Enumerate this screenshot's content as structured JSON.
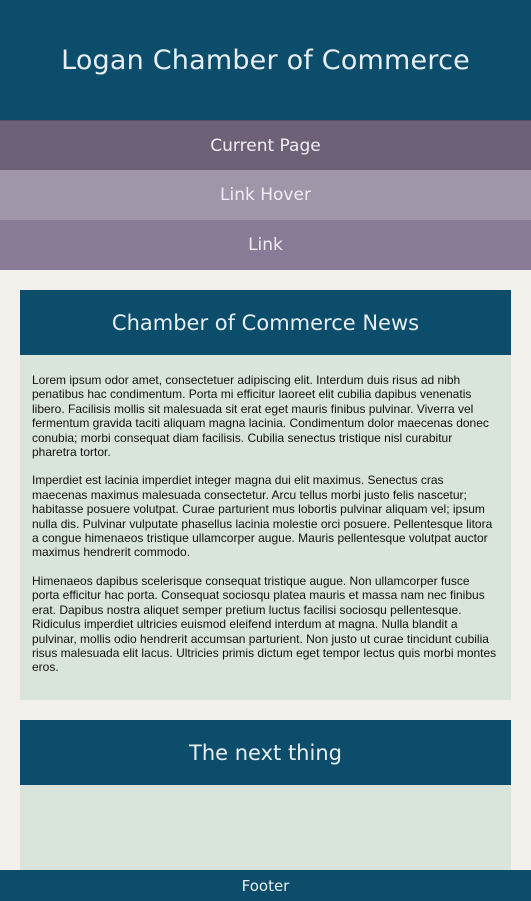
{
  "header": {
    "title": "Logan Chamber of Commerce"
  },
  "nav": {
    "items": [
      {
        "label": "Current Page",
        "state": "current"
      },
      {
        "label": "Link Hover",
        "state": "hover"
      },
      {
        "label": "Link",
        "state": "default"
      }
    ]
  },
  "main": {
    "cards": [
      {
        "title": "Chamber of Commerce News",
        "paragraphs": [
          "Lorem ipsum odor amet, consectetuer adipiscing elit. Interdum duis risus ad nibh penatibus hac condimentum. Porta mi efficitur laoreet elit cubilia dapibus venenatis libero. Facilisis mollis sit malesuada sit erat eget mauris finibus pulvinar. Viverra vel fermentum gravida taciti aliquam magna lacinia. Condimentum dolor maecenas donec conubia; morbi consequat diam facilisis. Cubilia senectus tristique nisl curabitur pharetra tortor.",
          "Imperdiet est lacinia imperdiet integer magna dui elit maximus. Senectus cras maecenas maximus malesuada consectetur. Arcu tellus morbi justo felis nascetur; habitasse posuere volutpat. Curae parturient mus lobortis pulvinar aliquam vel; ipsum nulla dis. Pulvinar vulputate phasellus lacinia molestie orci posuere. Pellentesque litora a congue himenaeos tristique ullamcorper augue. Mauris pellentesque volutpat auctor maximus hendrerit commodo.",
          "Himenaeos dapibus scelerisque consequat tristique augue. Non ullamcorper fusce porta efficitur hac porta. Consequat sociosqu platea mauris et massa nam nec finibus erat. Dapibus nostra aliquet semper pretium luctus facilisi sociosqu pellentesque. Ridiculus imperdiet ultricies euismod eleifend interdum at magna. Nulla blandit a pulvinar, mollis odio hendrerit accumsan parturient. Non justo ut curae tincidunt cubilia risus malesuada elit lacus. Ultricies primis dictum eget tempor lectus quis morbi montes eros."
        ]
      },
      {
        "title": "The next thing"
      }
    ]
  },
  "footer": {
    "label": "Footer"
  },
  "colors": {
    "primary": "#0b4d6b",
    "nav_current": "#6c6176",
    "nav_hover": "#9f96aa",
    "nav_link": "#877b95",
    "card_body": "#d9e5da",
    "page_background": "#f3f0ec"
  }
}
